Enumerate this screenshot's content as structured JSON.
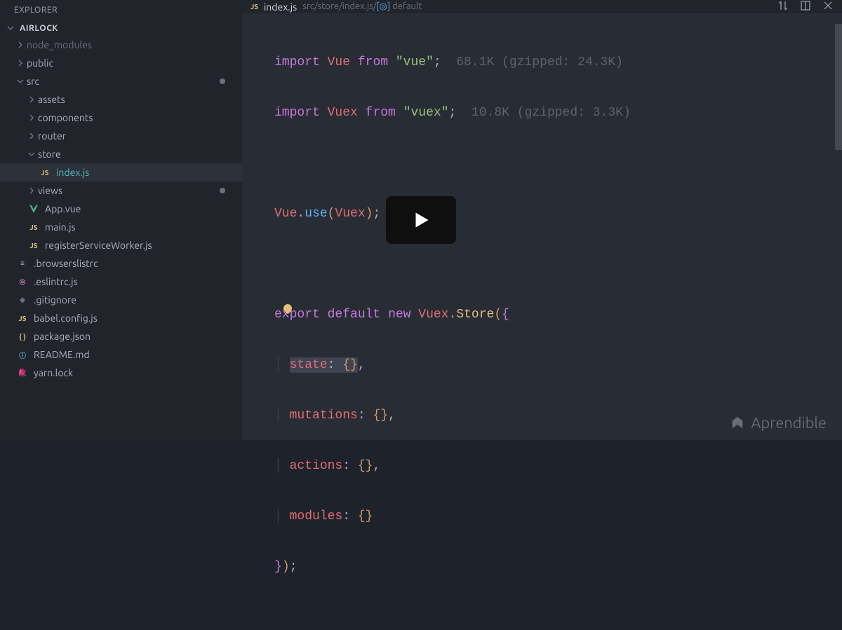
{
  "sidebar": {
    "title": "EXPLORER",
    "project": "AIRLOCK",
    "items": [
      {
        "label": "node_modules",
        "type": "folder",
        "state": "collapsed",
        "depth": 1,
        "dim": true
      },
      {
        "label": "public",
        "type": "folder",
        "state": "collapsed",
        "depth": 1
      },
      {
        "label": "src",
        "type": "folder",
        "state": "expanded",
        "depth": 1,
        "modified": true
      },
      {
        "label": "assets",
        "type": "folder",
        "state": "collapsed",
        "depth": 2
      },
      {
        "label": "components",
        "type": "folder",
        "state": "collapsed",
        "depth": 2
      },
      {
        "label": "router",
        "type": "folder",
        "state": "collapsed",
        "depth": 2
      },
      {
        "label": "store",
        "type": "folder",
        "state": "expanded",
        "depth": 2
      },
      {
        "label": "index.js",
        "type": "file",
        "icon": "js",
        "depth": 3,
        "active": true
      },
      {
        "label": "views",
        "type": "folder",
        "state": "collapsed",
        "depth": 2,
        "modified": true
      },
      {
        "label": "App.vue",
        "type": "file",
        "icon": "vue",
        "depth": 2
      },
      {
        "label": "main.js",
        "type": "file",
        "icon": "js",
        "depth": 2
      },
      {
        "label": "registerServiceWorker.js",
        "type": "file",
        "icon": "js",
        "depth": 2
      },
      {
        "label": ".browserslistrc",
        "type": "file",
        "icon": "txt",
        "depth": 1
      },
      {
        "label": ".eslintrc.js",
        "type": "file",
        "icon": "eslint",
        "depth": 1
      },
      {
        "label": ".gitignore",
        "type": "file",
        "icon": "git",
        "depth": 1
      },
      {
        "label": "babel.config.js",
        "type": "file",
        "icon": "js",
        "depth": 1
      },
      {
        "label": "package.json",
        "type": "file",
        "icon": "json",
        "depth": 1
      },
      {
        "label": "README.md",
        "type": "file",
        "icon": "md",
        "depth": 1
      },
      {
        "label": "yarn.lock",
        "type": "file",
        "icon": "yarn",
        "depth": 1
      }
    ]
  },
  "tab": {
    "icon": "JS",
    "name": "index.js",
    "breadcrumb_path": "src/store/index.js/",
    "breadcrumb_symbol": "default"
  },
  "code": {
    "line1": {
      "kw": "import",
      "var": "Vue",
      "from": "from",
      "str": "\"vue\"",
      "hint": "68.1K (gzipped: 24.3K)"
    },
    "line2": {
      "kw": "import",
      "var": "Vuex",
      "from": "from",
      "str": "\"vuex\"",
      "hint": "10.8K (gzipped: 3.3K)"
    },
    "line4": {
      "obj": "Vue",
      "method": "use",
      "arg": "Vuex"
    },
    "line6": {
      "export": "export",
      "default": "default",
      "new": "new",
      "cls": "Vuex",
      "ctor": "Store"
    },
    "line7": {
      "key": "state"
    },
    "line8": {
      "key": "mutations"
    },
    "line9": {
      "key": "actions"
    },
    "line10": {
      "key": "modules"
    }
  },
  "watermark": "Aprendible"
}
